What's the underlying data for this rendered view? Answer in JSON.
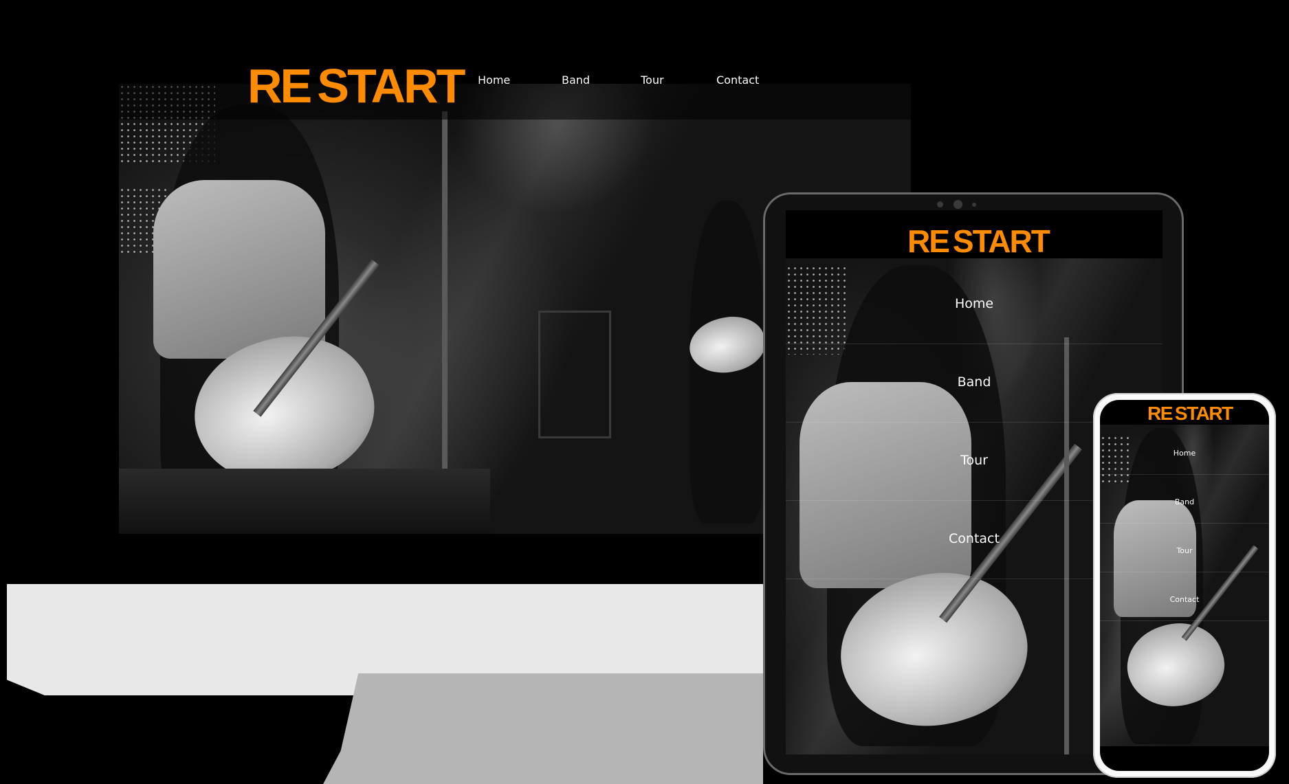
{
  "desktop": {
    "logo": {
      "part1": "RE",
      "part2": "START"
    },
    "nav": [
      "Home",
      "Band",
      "Tour",
      "Contact"
    ]
  },
  "tablet": {
    "logo": {
      "part1": "RE",
      "part2": "START"
    },
    "nav": [
      "Home",
      "Band",
      "Tour",
      "Contact"
    ]
  },
  "phone": {
    "logo": {
      "part1": "RE",
      "part2": "START"
    },
    "nav": [
      "Home",
      "Band",
      "Tour",
      "Contact"
    ]
  },
  "colors": {
    "brand": "#ff8c00",
    "background": "#000000",
    "stand_light": "#e8e8e8",
    "stand_shadow": "#b5b5b5"
  }
}
